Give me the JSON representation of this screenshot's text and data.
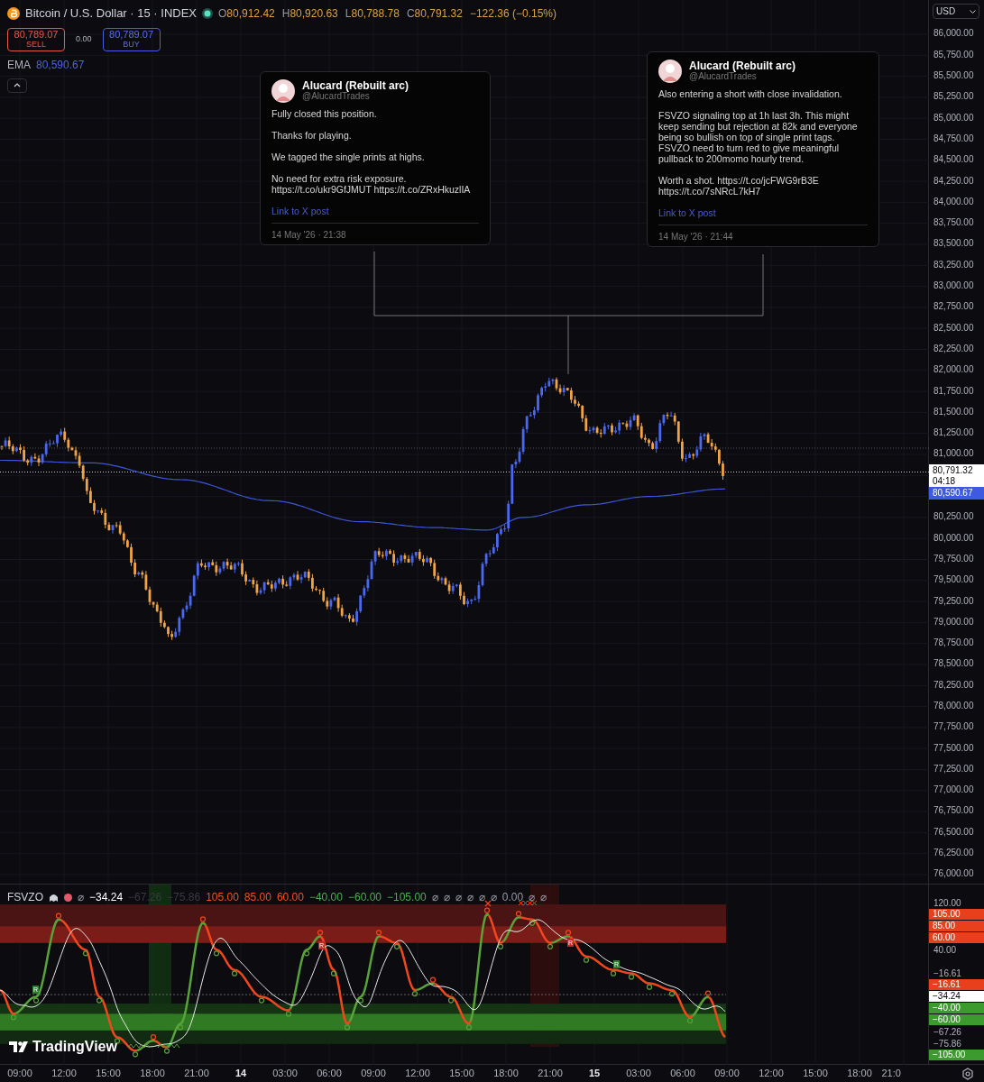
{
  "header": {
    "title": "Bitcoin / U.S. Dollar · 15 · INDEX",
    "ohlc": [
      {
        "label": "O",
        "value": "80,912.42"
      },
      {
        "label": "H",
        "value": "80,920.63"
      },
      {
        "label": "L",
        "value": "80,788.78"
      },
      {
        "label": "C",
        "value": "80,791.32"
      }
    ],
    "change": "−122.36 (−0.15%)"
  },
  "trade": {
    "sell_price": "80,789.07",
    "sell_label": "SELL",
    "spread": "0.00",
    "buy_price": "80,789.07",
    "buy_label": "BUY"
  },
  "ema_legend": {
    "label": "EMA",
    "value": "80,590.67"
  },
  "tweets": [
    {
      "author": "Alucard (Rebuilt arc)",
      "handle": "@AlucardTrades",
      "paragraphs": [
        "Fully closed this position.",
        "Thanks for playing.",
        "We tagged the single prints at highs.",
        "No need for extra risk exposure.\nhttps://t.co/ukr9GfJMUT https://t.co/ZRxHkuzlIA"
      ],
      "link": "Link to X post",
      "timestamp": "14 May '26 · 21:38"
    },
    {
      "author": "Alucard (Rebuilt arc)",
      "handle": "@AlucardTrades",
      "paragraphs": [
        "Also entering a short with close invalidation.",
        "FSVZO signaling top at 1h last 3h. This might\nkeep sending but rejection at 82k and everyone\nbeing so bullish on top of single print tags.\nFSVZO need to turn red to give meaningful\npullback to 200momo hourly trend.",
        "Worth a shot. https://t.co/jcFWG9rB3E\nhttps://t.co/7sNRcL7kH7"
      ],
      "link": "Link to X post",
      "timestamp": "14 May '26 · 21:44"
    }
  ],
  "price_axis": {
    "currency": "USD",
    "items": [
      {
        "kind": "tick",
        "label": "86,000.00"
      },
      {
        "kind": "tick",
        "label": "85,750.00"
      },
      {
        "kind": "tick",
        "label": "85,500.00"
      },
      {
        "kind": "tick",
        "label": "85,250.00"
      },
      {
        "kind": "tick",
        "label": "85,000.00"
      },
      {
        "kind": "tick",
        "label": "84,750.00"
      },
      {
        "kind": "tick",
        "label": "84,500.00"
      },
      {
        "kind": "tick",
        "label": "84,250.00"
      },
      {
        "kind": "tick",
        "label": "84,000.00"
      },
      {
        "kind": "tick",
        "label": "83,750.00"
      },
      {
        "kind": "tick",
        "label": "83,500.00"
      },
      {
        "kind": "tick",
        "label": "83,250.00"
      },
      {
        "kind": "tick",
        "label": "83,000.00"
      },
      {
        "kind": "tick",
        "label": "82,750.00"
      },
      {
        "kind": "tick",
        "label": "82,500.00"
      },
      {
        "kind": "tick",
        "label": "82,250.00"
      },
      {
        "kind": "tick",
        "label": "82,000.00"
      },
      {
        "kind": "tick",
        "label": "81,750.00"
      },
      {
        "kind": "tick",
        "label": "81,500.00"
      },
      {
        "kind": "tick",
        "label": "81,250.00"
      },
      {
        "kind": "tick",
        "label": "81,000.00"
      },
      {
        "kind": "last",
        "label": "80,791.32",
        "countdown": "04:18"
      },
      {
        "kind": "ema",
        "label": "80,590.67"
      },
      {
        "kind": "tick",
        "label": "80,250.00"
      },
      {
        "kind": "tick",
        "label": "80,000.00"
      },
      {
        "kind": "tick",
        "label": "79,750.00"
      },
      {
        "kind": "tick",
        "label": "79,500.00"
      },
      {
        "kind": "tick",
        "label": "79,250.00"
      },
      {
        "kind": "tick",
        "label": "79,000.00"
      },
      {
        "kind": "tick",
        "label": "78,750.00"
      },
      {
        "kind": "tick",
        "label": "78,500.00"
      },
      {
        "kind": "tick",
        "label": "78,250.00"
      },
      {
        "kind": "tick",
        "label": "78,000.00"
      },
      {
        "kind": "tick",
        "label": "77,750.00"
      },
      {
        "kind": "tick",
        "label": "77,500.00"
      },
      {
        "kind": "tick",
        "label": "77,250.00"
      },
      {
        "kind": "tick",
        "label": "77,000.00"
      },
      {
        "kind": "tick",
        "label": "76,750.00"
      },
      {
        "kind": "tick",
        "label": "76,500.00"
      },
      {
        "kind": "tick",
        "label": "76,250.00"
      },
      {
        "kind": "tick",
        "label": "76,000.00"
      }
    ]
  },
  "indicator": {
    "name": "FSVZO",
    "values": [
      {
        "text": "⌀",
        "color": "#9598a1"
      },
      {
        "text": "−34.24",
        "color": "#ffffff"
      },
      {
        "text": "−67.26",
        "color": "#3a3a40"
      },
      {
        "text": "−75.86",
        "color": "#3a3a40"
      },
      {
        "text": "105.00",
        "color": "#f4511e"
      },
      {
        "text": "85.00",
        "color": "#f4511e"
      },
      {
        "text": "60.00",
        "color": "#f4511e"
      },
      {
        "text": "−40.00",
        "color": "#4caf50"
      },
      {
        "text": "−60.00",
        "color": "#4caf50"
      },
      {
        "text": "−105.00",
        "color": "#4caf50"
      },
      {
        "text": "⌀",
        "color": "#9598a1"
      },
      {
        "text": "⌀",
        "color": "#9598a1"
      },
      {
        "text": "⌀",
        "color": "#9598a1"
      },
      {
        "text": "⌀",
        "color": "#9598a1"
      },
      {
        "text": "⌀",
        "color": "#9598a1"
      },
      {
        "text": "⌀",
        "color": "#9598a1"
      },
      {
        "text": "0.00",
        "color": "#9598a1"
      },
      {
        "text": "⌀",
        "color": "#9598a1"
      },
      {
        "text": "⌀",
        "color": "#9598a1"
      }
    ],
    "tags": [
      {
        "label": "R",
        "color": "#2e7d32"
      },
      {
        "label": "R",
        "color": "#c62828"
      },
      {
        "label": "R",
        "color": "#c62828"
      },
      {
        "label": "R",
        "color": "#2e7d32"
      }
    ],
    "axis": [
      {
        "kind": "tick",
        "label": "120.00"
      },
      {
        "kind": "badge",
        "label": "105.00",
        "color": "#e8401c"
      },
      {
        "kind": "badge",
        "label": "85.00",
        "color": "#e8401c"
      },
      {
        "kind": "badge",
        "label": "60.00",
        "color": "#e8401c"
      },
      {
        "kind": "tick",
        "label": "40.00"
      },
      {
        "kind": "tick",
        "label": "−16.61"
      },
      {
        "kind": "badge",
        "label": "−16.61",
        "color": "#e8401c"
      },
      {
        "kind": "badge",
        "label": "−34.24",
        "color": "#ffffff"
      },
      {
        "kind": "badge",
        "label": "−40.00",
        "color": "#3d9a2e"
      },
      {
        "kind": "badge",
        "label": "−60.00",
        "color": "#3d9a2e"
      },
      {
        "kind": "tick",
        "label": "−67.26"
      },
      {
        "kind": "tick",
        "label": "−75.86"
      },
      {
        "kind": "badge",
        "label": "−105.00",
        "color": "#3d9a2e"
      }
    ]
  },
  "logo": {
    "text": "TradingView"
  },
  "time_axis": [
    {
      "label": "09:00",
      "bold": false
    },
    {
      "label": "12:00",
      "bold": false
    },
    {
      "label": "15:00",
      "bold": false
    },
    {
      "label": "18:00",
      "bold": false
    },
    {
      "label": "21:00",
      "bold": false
    },
    {
      "label": "14",
      "bold": true
    },
    {
      "label": "03:00",
      "bold": false
    },
    {
      "label": "06:00",
      "bold": false
    },
    {
      "label": "09:00",
      "bold": false
    },
    {
      "label": "12:00",
      "bold": false
    },
    {
      "label": "15:00",
      "bold": false
    },
    {
      "label": "18:00",
      "bold": false
    },
    {
      "label": "21:00",
      "bold": false
    },
    {
      "label": "15",
      "bold": true
    },
    {
      "label": "03:00",
      "bold": false
    },
    {
      "label": "06:00",
      "bold": false
    },
    {
      "label": "09:00",
      "bold": false
    },
    {
      "label": "12:00",
      "bold": false
    },
    {
      "label": "15:00",
      "bold": false
    },
    {
      "label": "18:00",
      "bold": false
    },
    {
      "label": "21:0",
      "bold": false
    }
  ]
}
